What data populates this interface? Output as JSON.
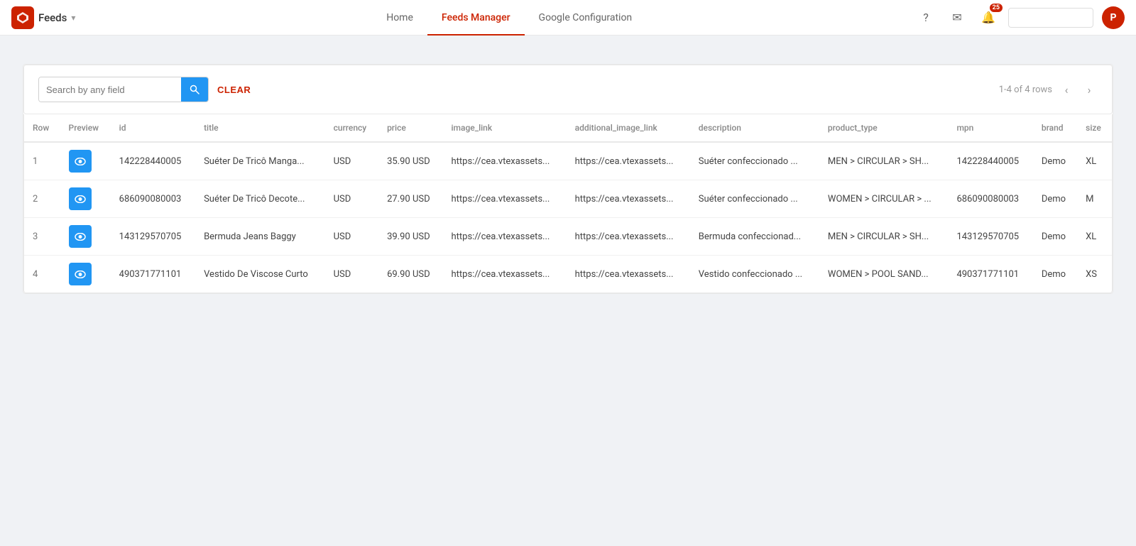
{
  "app": {
    "logo_text": "◆",
    "brand_label": "Feeds",
    "brand_arrow": "▾"
  },
  "nav": {
    "items": [
      {
        "label": "Home",
        "active": false
      },
      {
        "label": "Feeds Manager",
        "active": true
      },
      {
        "label": "Google Configuration",
        "active": false
      }
    ]
  },
  "topnav_right": {
    "search_placeholder": "",
    "notification_count": "25",
    "avatar_initials": "P"
  },
  "toolbar": {
    "search_placeholder": "Search by any field",
    "clear_label": "CLEAR",
    "pagination_text": "1-4 of 4 rows"
  },
  "table": {
    "columns": [
      {
        "key": "row",
        "label": "Row"
      },
      {
        "key": "preview",
        "label": "Preview"
      },
      {
        "key": "id",
        "label": "id"
      },
      {
        "key": "title",
        "label": "title"
      },
      {
        "key": "currency",
        "label": "currency"
      },
      {
        "key": "price",
        "label": "price"
      },
      {
        "key": "image_link",
        "label": "image_link"
      },
      {
        "key": "additional_image_link",
        "label": "additional_image_link"
      },
      {
        "key": "description",
        "label": "description"
      },
      {
        "key": "product_type",
        "label": "product_type"
      },
      {
        "key": "mpn",
        "label": "mpn"
      },
      {
        "key": "brand",
        "label": "brand"
      },
      {
        "key": "size",
        "label": "size"
      }
    ],
    "rows": [
      {
        "row": "1",
        "id": "142228440005",
        "title": "Suéter De Tricô Manga...",
        "currency": "USD",
        "price": "35.90 USD",
        "image_link": "https://cea.vtexassets...",
        "additional_image_link": "https://cea.vtexassets...",
        "description": "Suéter confeccionado ...",
        "product_type": "MEN > CIRCULAR > SH...",
        "mpn": "142228440005",
        "brand": "Demo",
        "size": "XL"
      },
      {
        "row": "2",
        "id": "686090080003",
        "title": "Suéter De Tricô Decote...",
        "currency": "USD",
        "price": "27.90 USD",
        "image_link": "https://cea.vtexassets...",
        "additional_image_link": "https://cea.vtexassets...",
        "description": "Suéter confeccionado ...",
        "product_type": "WOMEN > CIRCULAR > ...",
        "mpn": "686090080003",
        "brand": "Demo",
        "size": "M"
      },
      {
        "row": "3",
        "id": "143129570705",
        "title": "Bermuda Jeans Baggy",
        "currency": "USD",
        "price": "39.90 USD",
        "image_link": "https://cea.vtexassets...",
        "additional_image_link": "https://cea.vtexassets...",
        "description": "Bermuda confeccionad...",
        "product_type": "MEN > CIRCULAR > SH...",
        "mpn": "143129570705",
        "brand": "Demo",
        "size": "XL"
      },
      {
        "row": "4",
        "id": "490371771101",
        "title": "Vestido De Viscose Curto",
        "currency": "USD",
        "price": "69.90 USD",
        "image_link": "https://cea.vtexassets...",
        "additional_image_link": "https://cea.vtexassets...",
        "description": "Vestido confeccionado ...",
        "product_type": "WOMEN > POOL SAND...",
        "mpn": "490371771101",
        "brand": "Demo",
        "size": "XS"
      }
    ]
  }
}
